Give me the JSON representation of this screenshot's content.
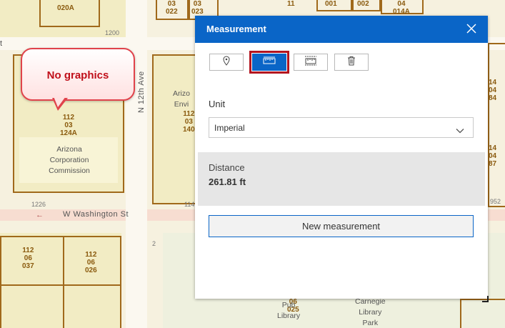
{
  "map": {
    "callout_text": "No graphics",
    "streets": {
      "washington": "W Washington St",
      "twelfth": "N 12th Ave",
      "left_edge": "t"
    },
    "addresses": {
      "a1200": "1200",
      "a1226": "1226",
      "a114": "114",
      "a952": "952",
      "a2": "2"
    },
    "parcels": {
      "p020a": "020A",
      "p03_022": "03\n022",
      "p03_023": "03\n023",
      "p001": "001",
      "p002": "002",
      "p04_014a": "04\n014A",
      "p112_124a": "112\n03\n124A",
      "p112_140": "112\n03\n140",
      "p112_037": "112\n06\n037",
      "p112_026": "112\n06\n026",
      "p025": "06\n025",
      "p_r1": "14\n04\n84",
      "p_r2": "14\n04\n87"
    },
    "buildings": {
      "corp": "Arizona\nCorporation\nCommission",
      "env": "Arizo\nEnvi",
      "library": "Pub\nLibrary",
      "carnegie": "Carnegie\nLibrary\nPark"
    },
    "labels_top": {
      "l11": "11"
    }
  },
  "panel": {
    "title": "Measurement",
    "tools": [
      {
        "name": "location",
        "icon": "map-pin-icon"
      },
      {
        "name": "distance",
        "icon": "ruler-icon",
        "active": true
      },
      {
        "name": "area",
        "icon": "area-icon"
      },
      {
        "name": "clear",
        "icon": "trash-icon"
      }
    ],
    "unit_label": "Unit",
    "unit_value": "Imperial",
    "result_label": "Distance",
    "result_value": "261.81 ft",
    "new_measurement": "New measurement"
  },
  "colors": {
    "accent": "#0a65c7",
    "highlight": "#b3141f",
    "parcel": "#a0691b",
    "callout": "#e0434b"
  }
}
